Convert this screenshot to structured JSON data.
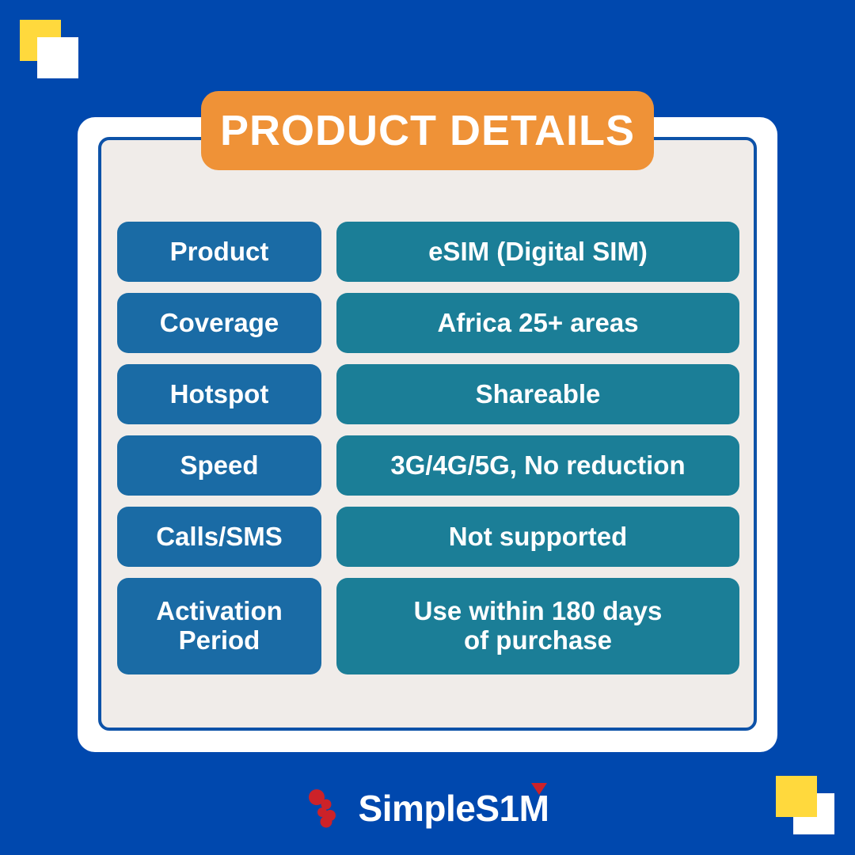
{
  "theme": {
    "background": "#0048ae",
    "card_frame": "#ffffff",
    "card_border": "#0d52a8",
    "panel": "#f0ece9",
    "badge_orange": "#ef9237",
    "label_blue": "#1a6ba5",
    "value_teal": "#1b7e97",
    "accent_yellow": "#ffd93d",
    "logo_red": "#cc2229"
  },
  "header": {
    "title": "PRODUCT DETAILS"
  },
  "spec_table": {
    "rows": [
      {
        "label": "Product",
        "value": "eSIM (Digital SIM)",
        "value_line2": ""
      },
      {
        "label": "Coverage",
        "value": "Africa 25+ areas",
        "value_line2": ""
      },
      {
        "label": "Hotspot",
        "value": "Shareable",
        "value_line2": ""
      },
      {
        "label": "Speed",
        "value": "3G/4G/5G, No reduction",
        "value_line2": ""
      },
      {
        "label": "Calls/SMS",
        "value": "Not supported",
        "value_line2": ""
      },
      {
        "label": "Activation Period",
        "value": "Use within 180 days",
        "value_line2": "of purchase"
      }
    ]
  },
  "footer": {
    "brand": "SimpleS1M",
    "logo_mark_name": "simplesim-dots-logo"
  }
}
